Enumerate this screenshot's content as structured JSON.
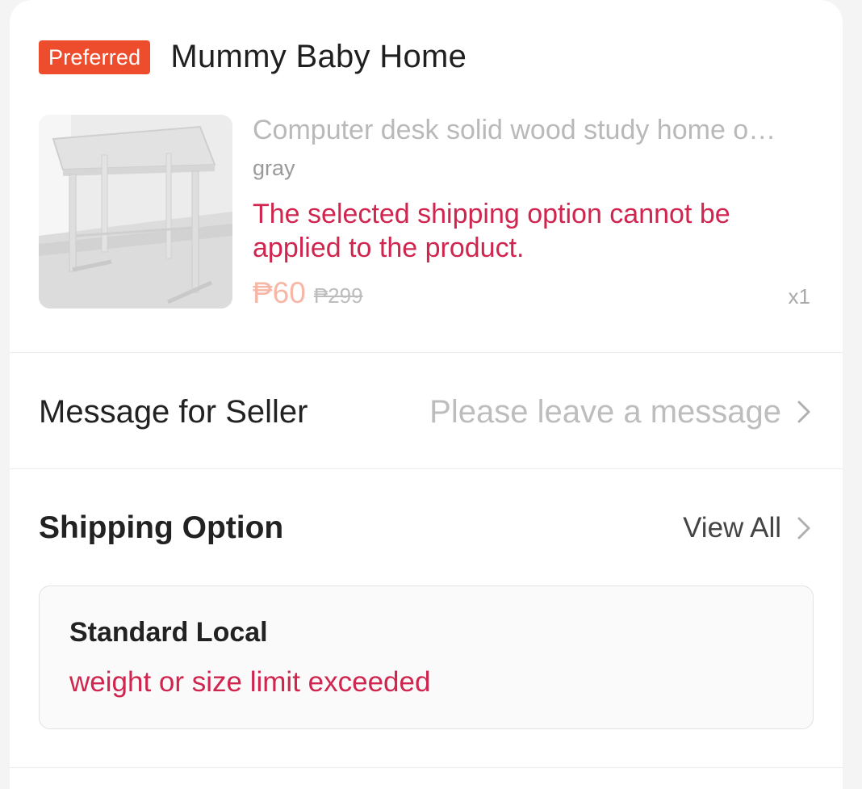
{
  "shop": {
    "badge": "Preferred",
    "name": "Mummy Baby Home"
  },
  "product": {
    "image_icon": "desk-product-image",
    "title": "Computer desk solid wood study home o…",
    "variant": "gray",
    "error": "The selected shipping option cannot be applied to the product.",
    "price": "₱60",
    "original_price": "₱299",
    "quantity": "x1"
  },
  "message": {
    "label": "Message for Seller",
    "placeholder": "Please leave a message"
  },
  "shipping": {
    "label": "Shipping Option",
    "view_all": "View All",
    "option_name": "Standard Local",
    "option_error": "weight or size limit exceeded"
  },
  "colors": {
    "brand": "#ee4d2d",
    "error": "#d0254e"
  }
}
